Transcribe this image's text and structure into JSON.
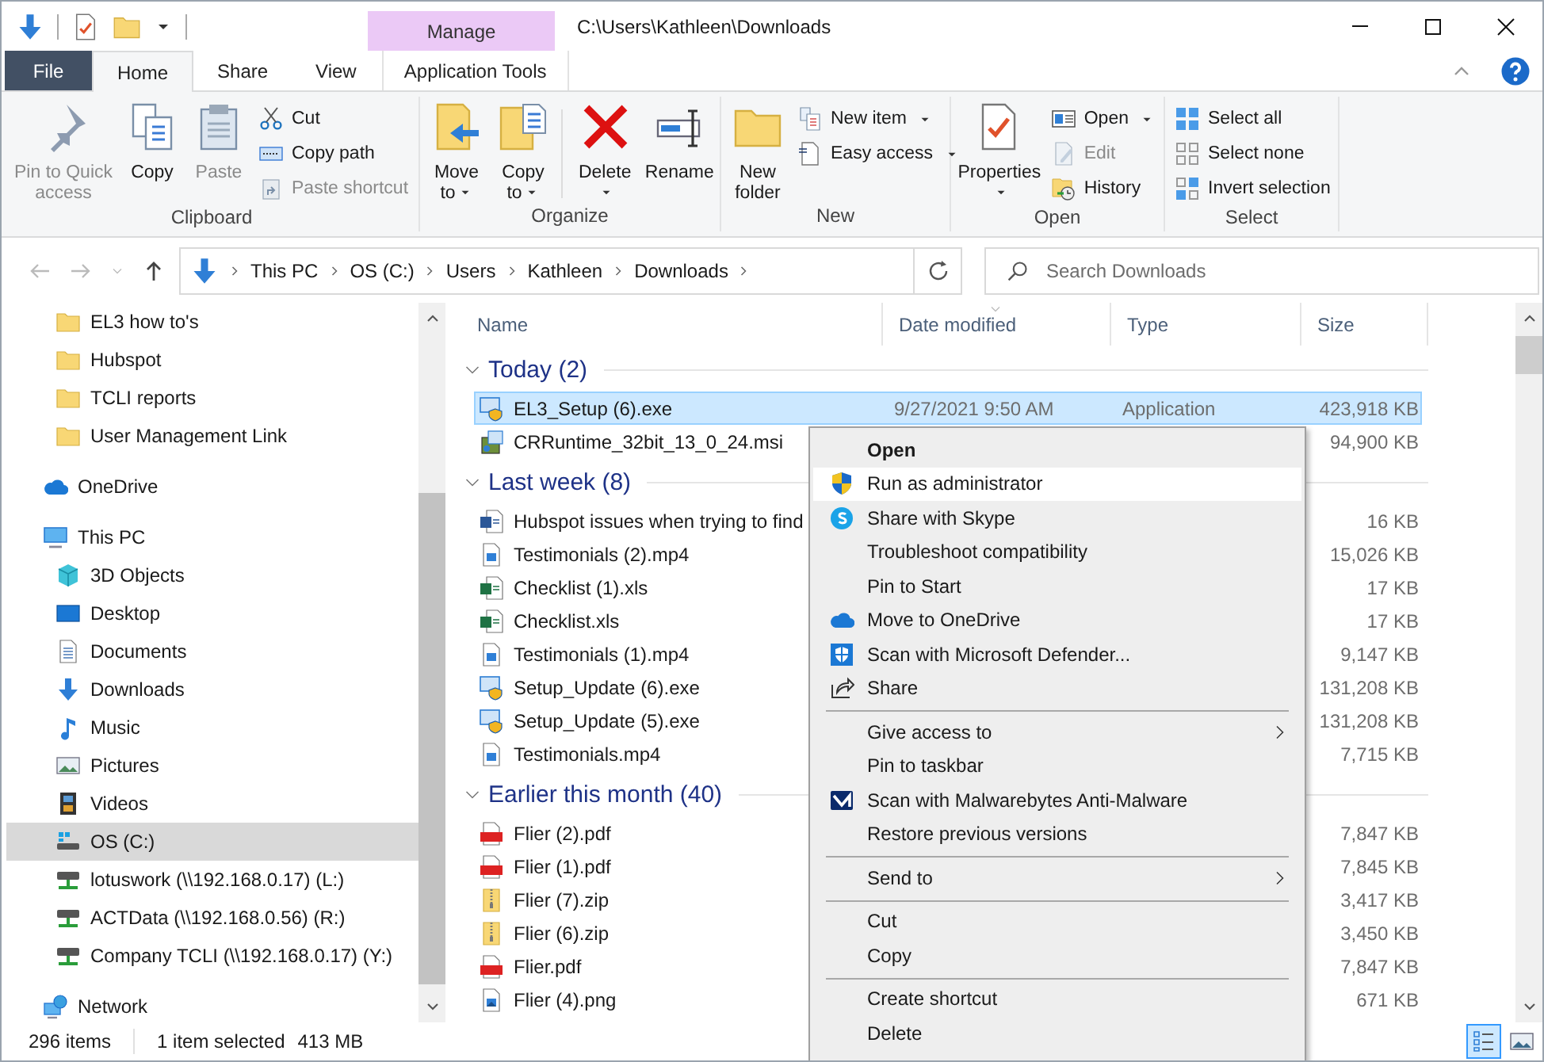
{
  "title_bar": {
    "contextual_tab": "Manage",
    "title": "C:\\Users\\Kathleen\\Downloads"
  },
  "tabs": [
    {
      "label": "File",
      "kind": "file",
      "selected": false
    },
    {
      "label": "Home",
      "kind": "tab",
      "selected": true
    },
    {
      "label": "Share",
      "kind": "tab",
      "selected": false
    },
    {
      "label": "View",
      "kind": "tab",
      "selected": false
    },
    {
      "label": "Application Tools",
      "kind": "contextual",
      "selected": false
    }
  ],
  "ribbon": [
    {
      "label": "Clipboard",
      "items": [
        {
          "kind": "large",
          "label": "Pin to Quick\naccess",
          "disabled": true,
          "dropdown": false
        },
        {
          "kind": "large",
          "label": "Copy",
          "disabled": false,
          "dropdown": false
        },
        {
          "kind": "large",
          "label": "Paste",
          "disabled": true,
          "dropdown": false
        },
        {
          "kind": "stack",
          "items": [
            {
              "label": "Cut",
              "disabled": false,
              "dropdown": false
            },
            {
              "label": "Copy path",
              "disabled": false,
              "dropdown": false
            },
            {
              "label": "Paste shortcut",
              "disabled": true,
              "dropdown": false
            }
          ]
        }
      ]
    },
    {
      "label": "Organize",
      "items": [
        {
          "kind": "large",
          "label": "Move\nto",
          "disabled": false,
          "dropdown": true
        },
        {
          "kind": "large",
          "label": "Copy\nto",
          "disabled": false,
          "dropdown": true
        },
        {
          "kind": "separator"
        },
        {
          "kind": "large",
          "label": "Delete",
          "disabled": false,
          "dropdown": true
        },
        {
          "kind": "large",
          "label": "Rename",
          "disabled": false,
          "dropdown": false
        }
      ]
    },
    {
      "label": "New",
      "items": [
        {
          "kind": "large",
          "label": "New\nfolder",
          "disabled": false,
          "dropdown": false
        },
        {
          "kind": "stack",
          "items": [
            {
              "label": "New item",
              "disabled": false,
              "dropdown": true
            },
            {
              "label": "Easy access",
              "disabled": false,
              "dropdown": true
            }
          ]
        }
      ]
    },
    {
      "label": "Open",
      "items": [
        {
          "kind": "large",
          "label": "Properties",
          "disabled": false,
          "dropdown": true
        },
        {
          "kind": "stack",
          "items": [
            {
              "label": "Open",
              "disabled": false,
              "dropdown": true
            },
            {
              "label": "Edit",
              "disabled": true,
              "dropdown": false
            },
            {
              "label": "History",
              "disabled": false,
              "dropdown": false
            }
          ]
        }
      ]
    },
    {
      "label": "Select",
      "items": [
        {
          "kind": "stack",
          "items": [
            {
              "label": "Select all",
              "disabled": false,
              "dropdown": false
            },
            {
              "label": "Select none",
              "disabled": false,
              "dropdown": false
            },
            {
              "label": "Invert selection",
              "disabled": false,
              "dropdown": false
            }
          ]
        }
      ]
    }
  ],
  "address": {
    "breadcrumbs": [
      "This PC",
      "OS (C:)",
      "Users",
      "Kathleen",
      "Downloads"
    ]
  },
  "search": {
    "placeholder": "Search Downloads"
  },
  "sidebar": {
    "quick_access_items": [
      {
        "label": "EL3 how to's",
        "selected": false
      },
      {
        "label": "Hubspot",
        "selected": false
      },
      {
        "label": "TCLI reports",
        "selected": false
      },
      {
        "label": "User Management Link",
        "selected": false
      }
    ],
    "items": [
      {
        "label": "OneDrive",
        "selected": false
      },
      {
        "label": "This PC",
        "selected": false,
        "children": [
          {
            "label": "3D Objects",
            "selected": false
          },
          {
            "label": "Desktop",
            "selected": false
          },
          {
            "label": "Documents",
            "selected": false
          },
          {
            "label": "Downloads",
            "selected": false
          },
          {
            "label": "Music",
            "selected": false
          },
          {
            "label": "Pictures",
            "selected": false
          },
          {
            "label": "Videos",
            "selected": false
          },
          {
            "label": "OS (C:)",
            "selected": true
          },
          {
            "label": "lotuswork (\\\\192.168.0.17) (L:)",
            "selected": false
          },
          {
            "label": "ACTData (\\\\192.168.0.56) (R:)",
            "selected": false
          },
          {
            "label": "Company TCLI (\\\\192.168.0.17) (Y:)",
            "selected": false
          }
        ]
      },
      {
        "label": "Network",
        "selected": false
      }
    ]
  },
  "columns": [
    {
      "label": "Name",
      "sorted": false
    },
    {
      "label": "Date modified",
      "sorted": true
    },
    {
      "label": "Type",
      "sorted": false
    },
    {
      "label": "Size",
      "sorted": false
    }
  ],
  "groups": [
    {
      "label": "Today (2)",
      "expanded": true,
      "files": [
        {
          "name": "EL3_Setup (6).exe",
          "date": "9/27/2021 9:50 AM",
          "type": "Application",
          "size": "423,918 KB",
          "selected": true
        },
        {
          "name": "CRRuntime_32bit_13_0_24.msi",
          "size": "94,900 KB",
          "selected": false
        }
      ]
    },
    {
      "label": "Last week (8)",
      "expanded": true,
      "files": [
        {
          "name": "Hubspot issues when trying to find",
          "size": "16 KB",
          "selected": false
        },
        {
          "name": "Testimonials (2).mp4",
          "size": "15,026 KB",
          "selected": false
        },
        {
          "name": "Checklist (1).xls",
          "size": "17 KB",
          "selected": false
        },
        {
          "name": "Checklist.xls",
          "size": "17 KB",
          "selected": false
        },
        {
          "name": "Testimonials (1).mp4",
          "size": "9,147 KB",
          "selected": false
        },
        {
          "name": "Setup_Update (6).exe",
          "size": "131,208 KB",
          "selected": false
        },
        {
          "name": "Setup_Update (5).exe",
          "size": "131,208 KB",
          "selected": false
        },
        {
          "name": "Testimonials.mp4",
          "size": "7,715 KB",
          "selected": false
        }
      ]
    },
    {
      "label": "Earlier this month (40)",
      "expanded": true,
      "files": [
        {
          "name": "Flier (2).pdf",
          "size": "7,847 KB",
          "selected": false
        },
        {
          "name": "Flier (1).pdf",
          "size": "7,845 KB",
          "selected": false
        },
        {
          "name": "Flier (7).zip",
          "size": "3,417 KB",
          "selected": false
        },
        {
          "name": "Flier (6).zip",
          "size": "3,450 KB",
          "selected": false
        },
        {
          "name": "Flier.pdf",
          "size": "7,847 KB",
          "selected": false
        },
        {
          "name": "Flier (4).png",
          "size": "671 KB",
          "selected": false
        }
      ]
    }
  ],
  "context_menu": {
    "sections": [
      [
        {
          "label": "Open",
          "default": true,
          "highlighted": false,
          "submenu": false
        },
        {
          "label": "Run as administrator",
          "default": false,
          "highlighted": true,
          "submenu": false
        },
        {
          "label": "Share with Skype",
          "default": false,
          "highlighted": false,
          "submenu": false
        },
        {
          "label": "Troubleshoot compatibility",
          "default": false,
          "highlighted": false,
          "submenu": false
        },
        {
          "label": "Pin to Start",
          "default": false,
          "highlighted": false,
          "submenu": false
        },
        {
          "label": "Move to OneDrive",
          "default": false,
          "highlighted": false,
          "submenu": false
        },
        {
          "label": "Scan with Microsoft Defender...",
          "default": false,
          "highlighted": false,
          "submenu": false
        },
        {
          "label": "Share",
          "default": false,
          "highlighted": false,
          "submenu": false
        }
      ],
      [
        {
          "label": "Give access to",
          "default": false,
          "highlighted": false,
          "submenu": true
        },
        {
          "label": "Pin to taskbar",
          "default": false,
          "highlighted": false,
          "submenu": false
        },
        {
          "label": "Scan with Malwarebytes Anti-Malware",
          "default": false,
          "highlighted": false,
          "submenu": false
        },
        {
          "label": "Restore previous versions",
          "default": false,
          "highlighted": false,
          "submenu": false
        }
      ],
      [
        {
          "label": "Send to",
          "default": false,
          "highlighted": false,
          "submenu": true
        }
      ],
      [
        {
          "label": "Cut",
          "default": false,
          "highlighted": false,
          "submenu": false
        },
        {
          "label": "Copy",
          "default": false,
          "highlighted": false,
          "submenu": false
        }
      ],
      [
        {
          "label": "Create shortcut",
          "default": false,
          "highlighted": false,
          "submenu": false
        },
        {
          "label": "Delete",
          "default": false,
          "highlighted": false,
          "submenu": false
        }
      ]
    ]
  },
  "status_bar": {
    "item_count": "296 items",
    "selection": "1 item selected",
    "selection_size": "413 MB"
  },
  "view_buttons": [
    {
      "selected": true
    },
    {
      "selected": false
    }
  ]
}
